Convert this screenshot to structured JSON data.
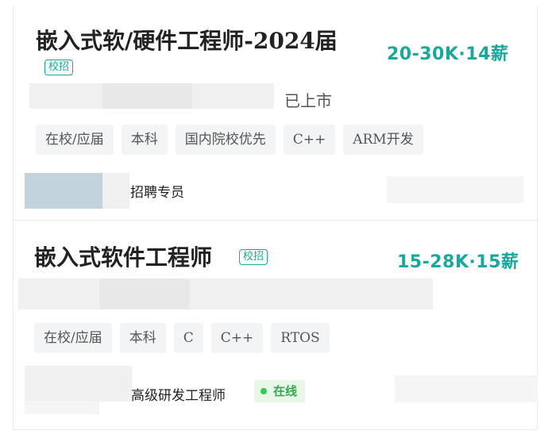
{
  "jobs": [
    {
      "title": "嵌入式软/硬件工程师-2024届",
      "badge": "校招",
      "salary": "20-30K·14薪",
      "company_status": "已上市",
      "tags": [
        "在校/应届",
        "本科",
        "国内院校优先",
        "C++",
        "ARM开发"
      ],
      "recruiter_title": "招聘专员"
    },
    {
      "title": "嵌入式软件工程师",
      "badge": "校招",
      "salary": "15-28K·15薪",
      "tags": [
        "在校/应届",
        "本科",
        "C",
        "C++",
        "RTOS"
      ],
      "recruiter_title": "高级研发工程师",
      "online_label": "在线"
    }
  ],
  "colors": {
    "accent": "#1aa89c",
    "online_green": "#34a853",
    "tag_bg": "#f3f4f5"
  }
}
